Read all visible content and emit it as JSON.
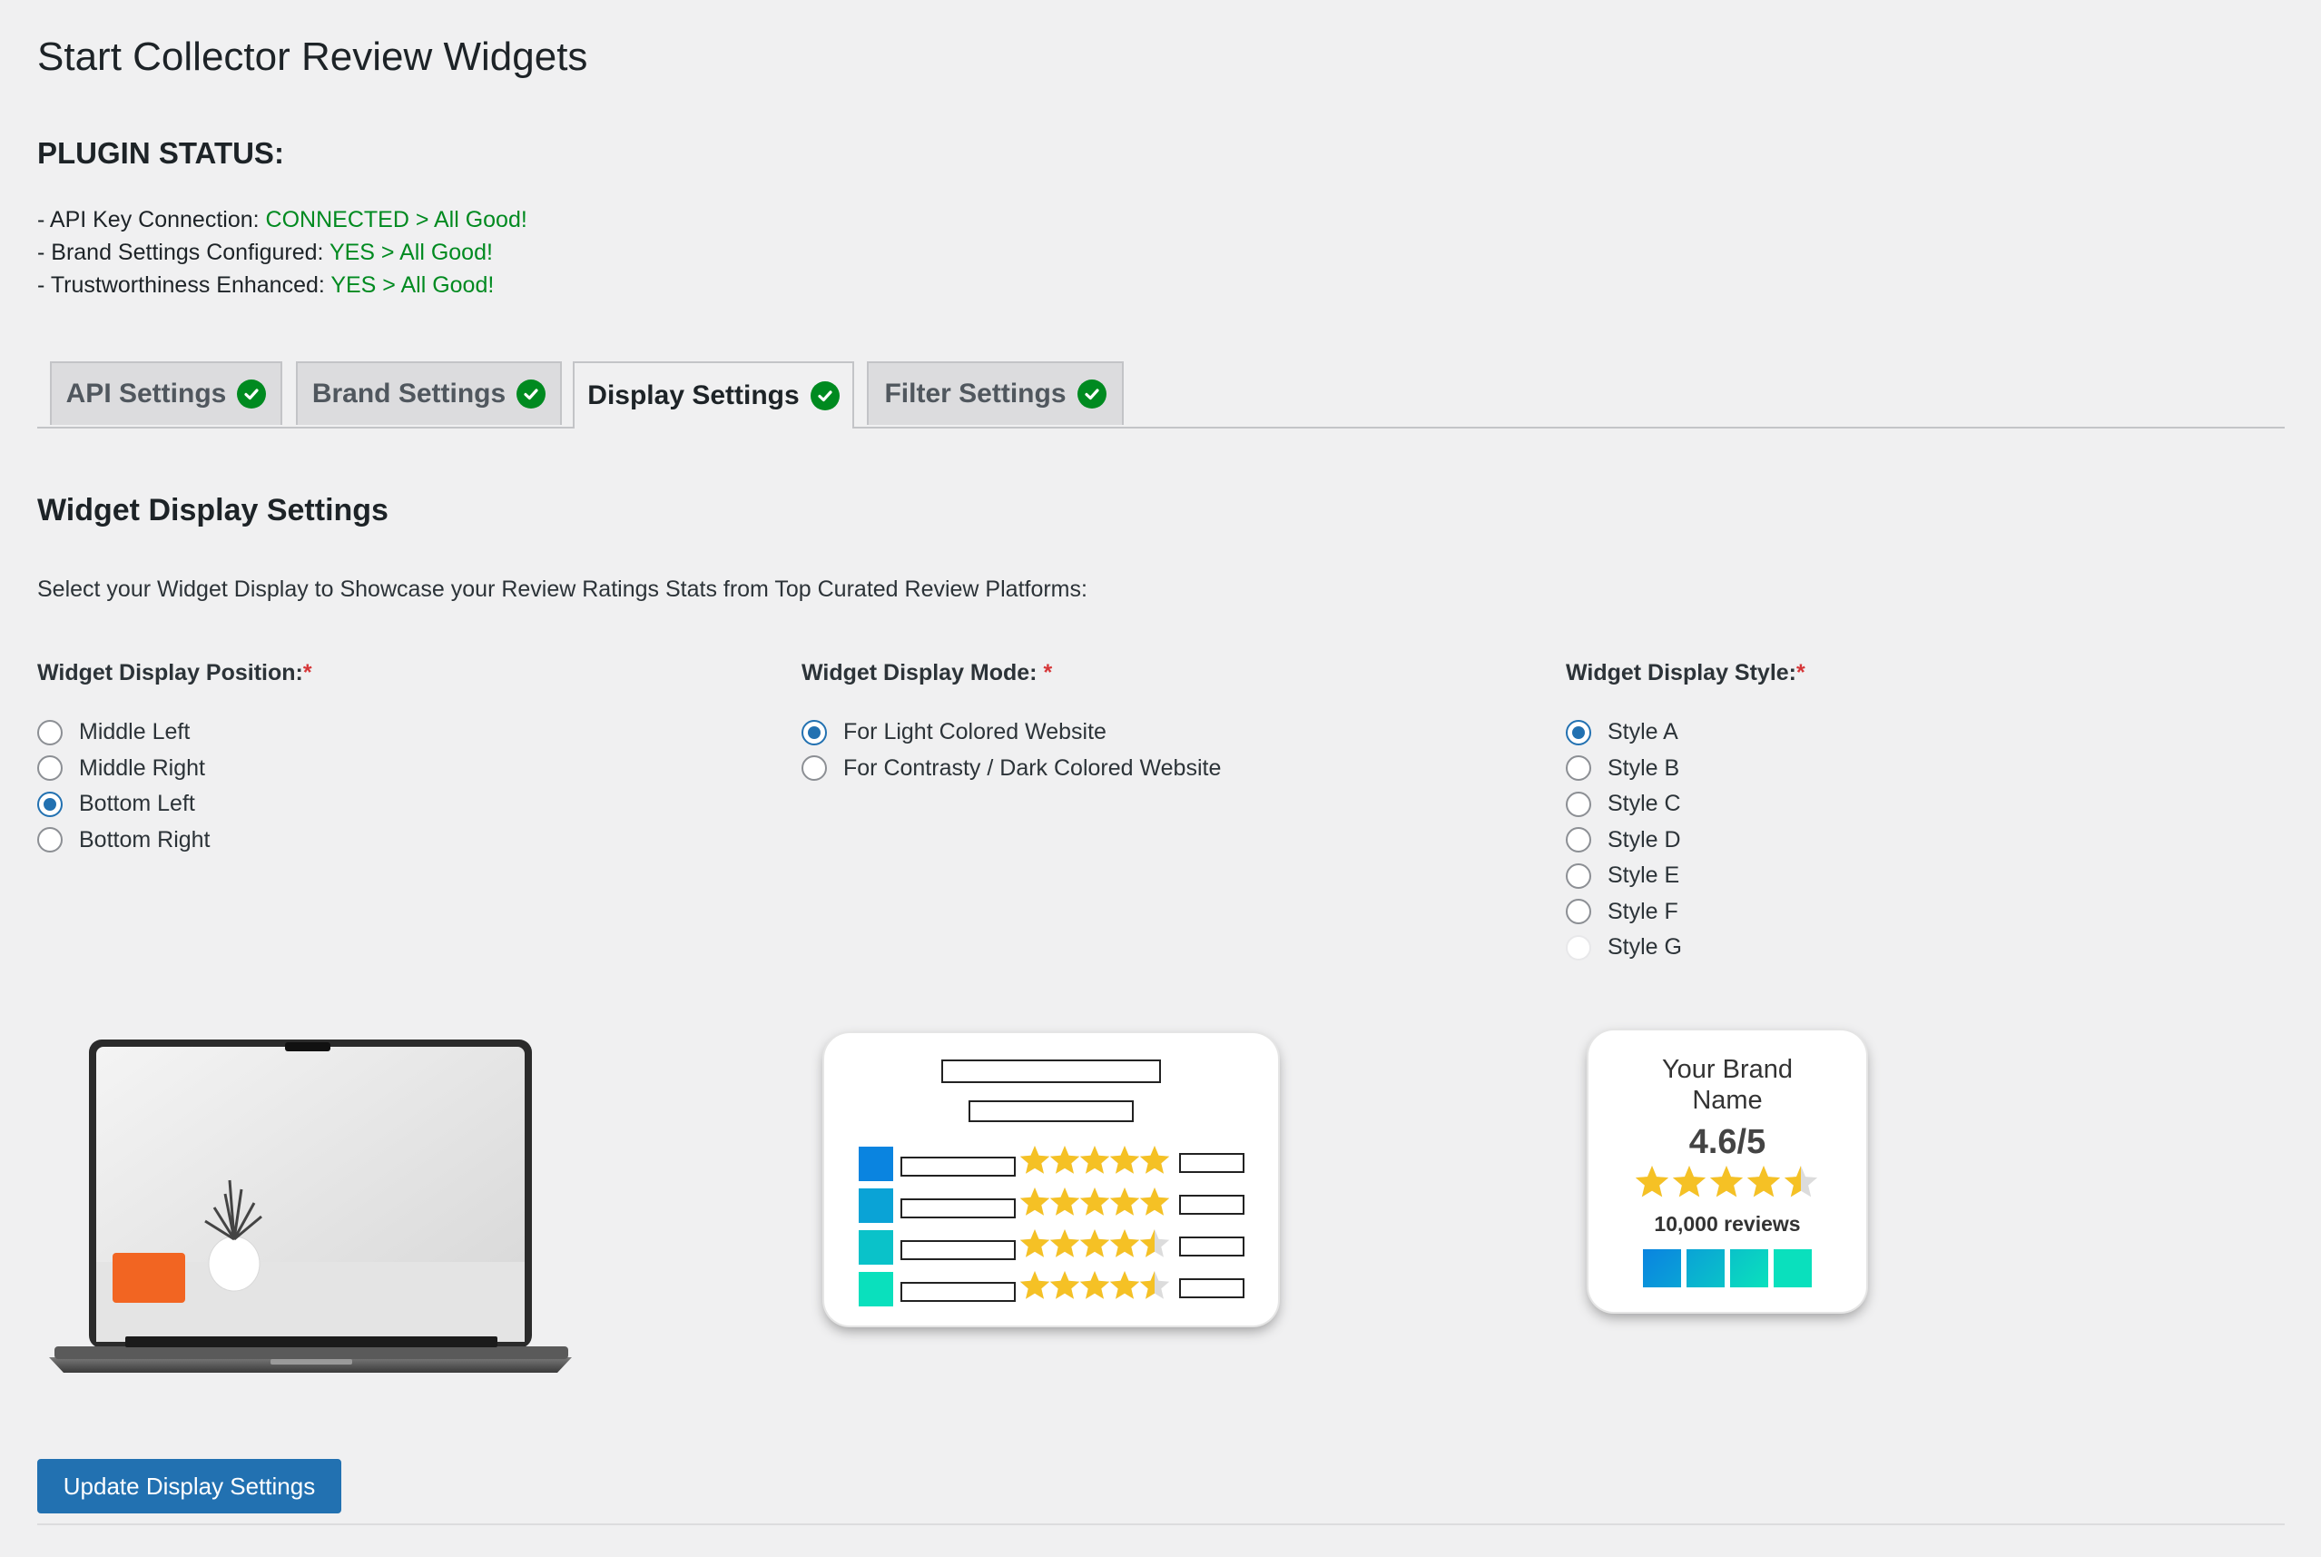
{
  "page": {
    "title": "Start Collector Review Widgets"
  },
  "status": {
    "heading": "PLUGIN STATUS:",
    "rows": [
      {
        "label": "- API Key Connection: ",
        "value": "CONNECTED > All Good!"
      },
      {
        "label": "- Brand Settings Configured: ",
        "value": "YES > All Good!"
      },
      {
        "label": "- Trustworthiness Enhanced: ",
        "value": "YES > All Good!"
      }
    ],
    "ok_color": "#008a20"
  },
  "tabs": [
    {
      "label": "API Settings",
      "active": false,
      "icon": "check-circle-icon"
    },
    {
      "label": "Brand Settings",
      "active": false,
      "icon": "check-circle-icon"
    },
    {
      "label": "Display Settings",
      "active": true,
      "icon": "check-circle-icon"
    },
    {
      "label": "Filter Settings",
      "active": false,
      "icon": "check-circle-icon"
    }
  ],
  "section": {
    "title": "Widget Display Settings",
    "description": "Select your Widget Display to Showcase your Review Ratings Stats from Top Curated Review Platforms:"
  },
  "position": {
    "label": "Widget Display Position:",
    "required": "*",
    "options": [
      "Middle Left",
      "Middle Right",
      "Bottom Left",
      "Bottom Right"
    ],
    "selected": "Bottom Left"
  },
  "mode": {
    "label": "Widget Display Mode: ",
    "required": "*",
    "options": [
      "For Light Colored Website",
      "For Contrasty / Dark Colored Website"
    ],
    "selected": "For Light Colored Website"
  },
  "style": {
    "label": "Widget Display Style:",
    "required": "*",
    "options": [
      "Style A",
      "Style B",
      "Style C",
      "Style D",
      "Style E",
      "Style F",
      "Style G"
    ],
    "selected": "Style A"
  },
  "preview_card": {
    "brand_name_line1": "Your Brand",
    "brand_name_line2": "Name",
    "score": "4.6/5",
    "reviews": "10,000 reviews"
  },
  "colors": {
    "accent": "#2271b1",
    "orange_widget": "#f26522",
    "star": "#f5c125",
    "platform_squares": [
      "#0a84e0",
      "#0aa3d6",
      "#0ac2c9",
      "#0ae0bd"
    ]
  },
  "actions": {
    "update_label": "Update Display Settings"
  }
}
